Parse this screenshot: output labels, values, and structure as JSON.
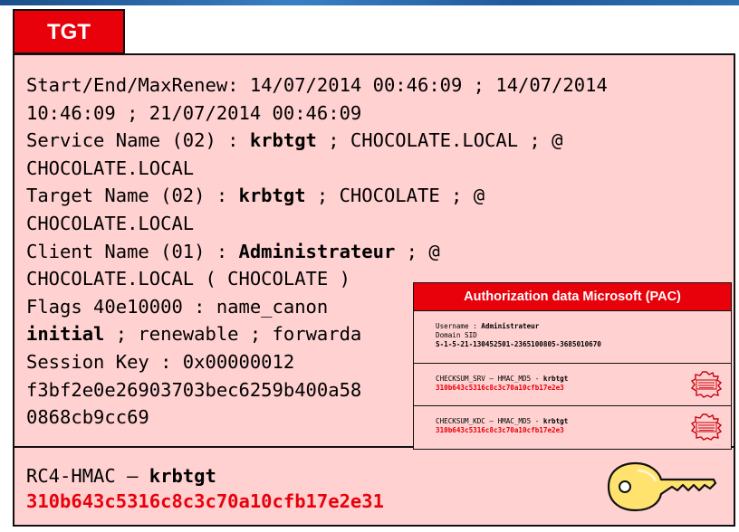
{
  "tab": {
    "label": "TGT"
  },
  "ticket": {
    "l1": "Start/End/MaxRenew: 14/07/2014 00:46:09 ; 14/07/2014",
    "l2": "10:46:09 ; 21/07/2014 00:46:09",
    "l3_pre": "Service Name (02) : ",
    "l3_bold": "krbtgt",
    "l3_post": " ; CHOCOLATE.LOCAL ; @",
    "l4": "CHOCOLATE.LOCAL",
    "l5_pre": "Target Name  (02) : ",
    "l5_bold": "krbtgt",
    "l5_post": " ; CHOCOLATE ; @",
    "l6": "CHOCOLATE.LOCAL",
    "l7_pre": "Client Name  (01) : ",
    "l7_bold": "Administrateur",
    "l7_post": " ; @",
    "l8": "CHOCOLATE.LOCAL ( CHOCOLATE )",
    "l9": "Flags 40e10000    : name_canon",
    "l10_bold": "initial",
    "l10_post": " ; renewable ; forwarda",
    "l11": "Session Key       : 0x00000012",
    "l12": "f3bf2e0e26903703bec6259b400a58",
    "l13": "0868cb9cc69"
  },
  "key": {
    "algo_pre": "RC4-HMAC – ",
    "algo_bold": "krbtgt",
    "hash": "310b643c5316c8c3c70a10cfb17e2e31"
  },
  "pac": {
    "title": "Authorization data Microsoft (PAC)",
    "username_pre": "Username : ",
    "username": "Administrateur",
    "domain_sid_label": "Domain SID",
    "domain_sid": "S-1-5-21-130452501-2365100805-3685010670",
    "checksum_srv_pre": "CHECKSUM_SRV – HMAC_MD5 - ",
    "checksum_srv_bold": "krbtgt",
    "checksum_srv_hash": "310b643c5316c8c3c70a10cfb17e2e3",
    "checksum_kdc_pre": "CHECKSUM_KDC – HMAC_MD5 - ",
    "checksum_kdc_bold": "krbtgt",
    "checksum_kdc_hash": "310b643c5316c8c3c70a10cfb17e2e3"
  },
  "colors": {
    "accent_red": "#e8000a",
    "panel_pink": "#ffd1d1",
    "key_yellow": "#ffe36e"
  },
  "icons": {
    "key": "key-icon",
    "stamp": "certified-stamp-icon"
  }
}
